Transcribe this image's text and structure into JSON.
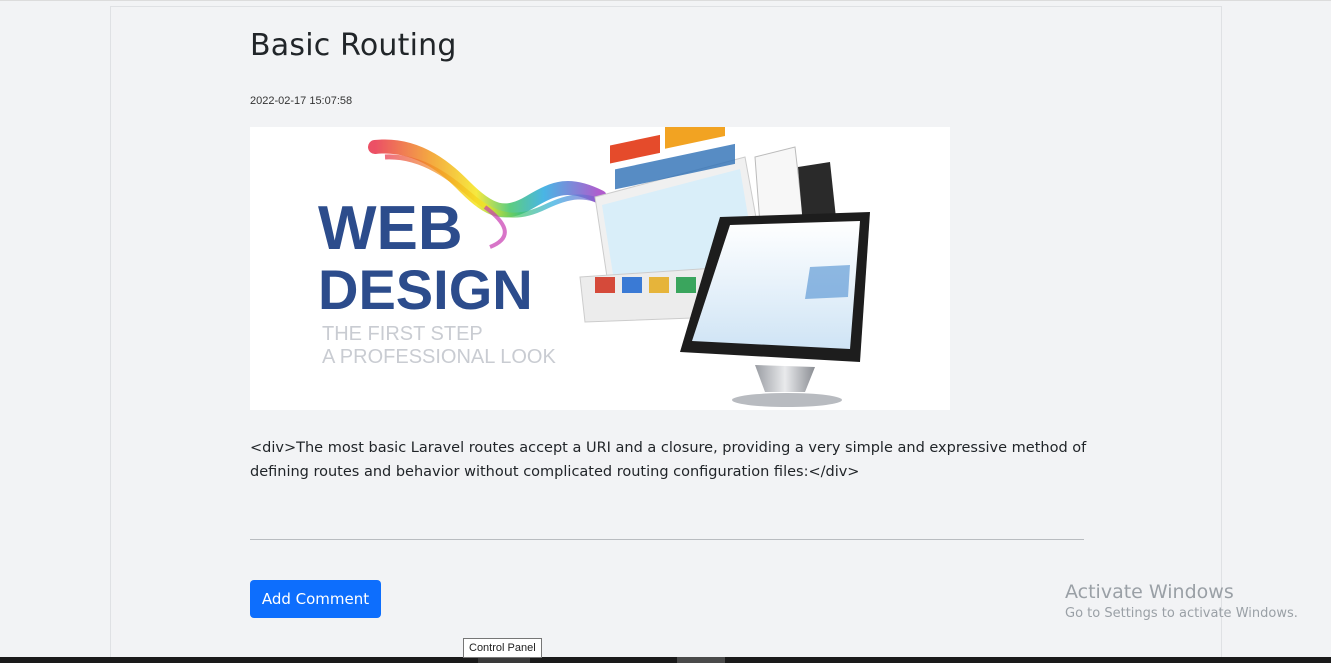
{
  "post": {
    "title": "Basic Routing",
    "date": "2022-02-17 15:07:58",
    "body": "<div>The most basic Laravel routes accept a URI and a closure, providing a very simple and expressive method of defining routes and behavior without complicated routing configuration files:</div>"
  },
  "hero_image": {
    "headline_line1": "WEB",
    "headline_line2": "DESIGN",
    "tagline_line1": "THE FIRST STEP",
    "tagline_line2": "A PROFESSIONAL LOOK",
    "headline_color": "#2c4c8c",
    "tagline_color": "#c9ccd2"
  },
  "actions": {
    "add_comment_label": "Add Comment",
    "button_color": "#0d6efd"
  },
  "watermark": {
    "title": "Activate Windows",
    "subtitle": "Go to Settings to activate Windows."
  },
  "taskbar": {
    "tooltip": "Control Panel"
  }
}
